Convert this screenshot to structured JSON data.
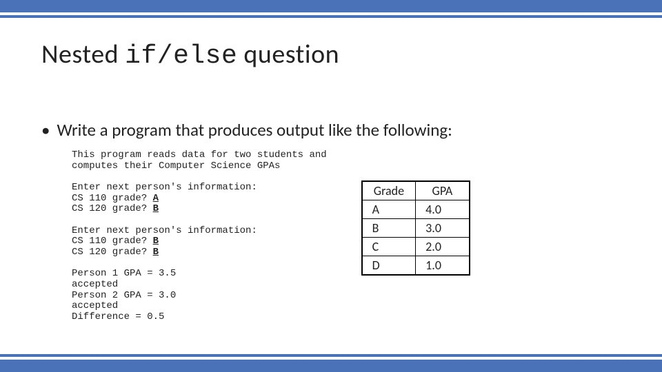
{
  "title": {
    "pre": "Nested ",
    "code": "if/else",
    "post": " question"
  },
  "bullet": "Write a program that produces output like the following:",
  "sample": {
    "intro1": "This program reads data for two students and",
    "intro2": "computes their Computer Science GPAs",
    "blank": "",
    "enter1": "Enter next person's information:",
    "p1q1": "CS 110 grade? ",
    "p1a1": "A",
    "p1q2": "CS 120 grade? ",
    "p1a2": "B",
    "enter2": "Enter next person's information:",
    "p2q1": "CS 110 grade? ",
    "p2a1": "B",
    "p2q2": "CS 120 grade? ",
    "p2a2": "B",
    "r1": "Person 1 GPA = 3.5",
    "r2": "accepted",
    "r3": "Person 2 GPA = 3.0",
    "r4": "accepted",
    "r5": "Difference = 0.5"
  },
  "table": {
    "h1": "Grade",
    "h2": "GPA",
    "rows": [
      {
        "g": "A",
        "p": "4.0"
      },
      {
        "g": "B",
        "p": "3.0"
      },
      {
        "g": "C",
        "p": "2.0"
      },
      {
        "g": "D",
        "p": "1.0"
      }
    ]
  }
}
